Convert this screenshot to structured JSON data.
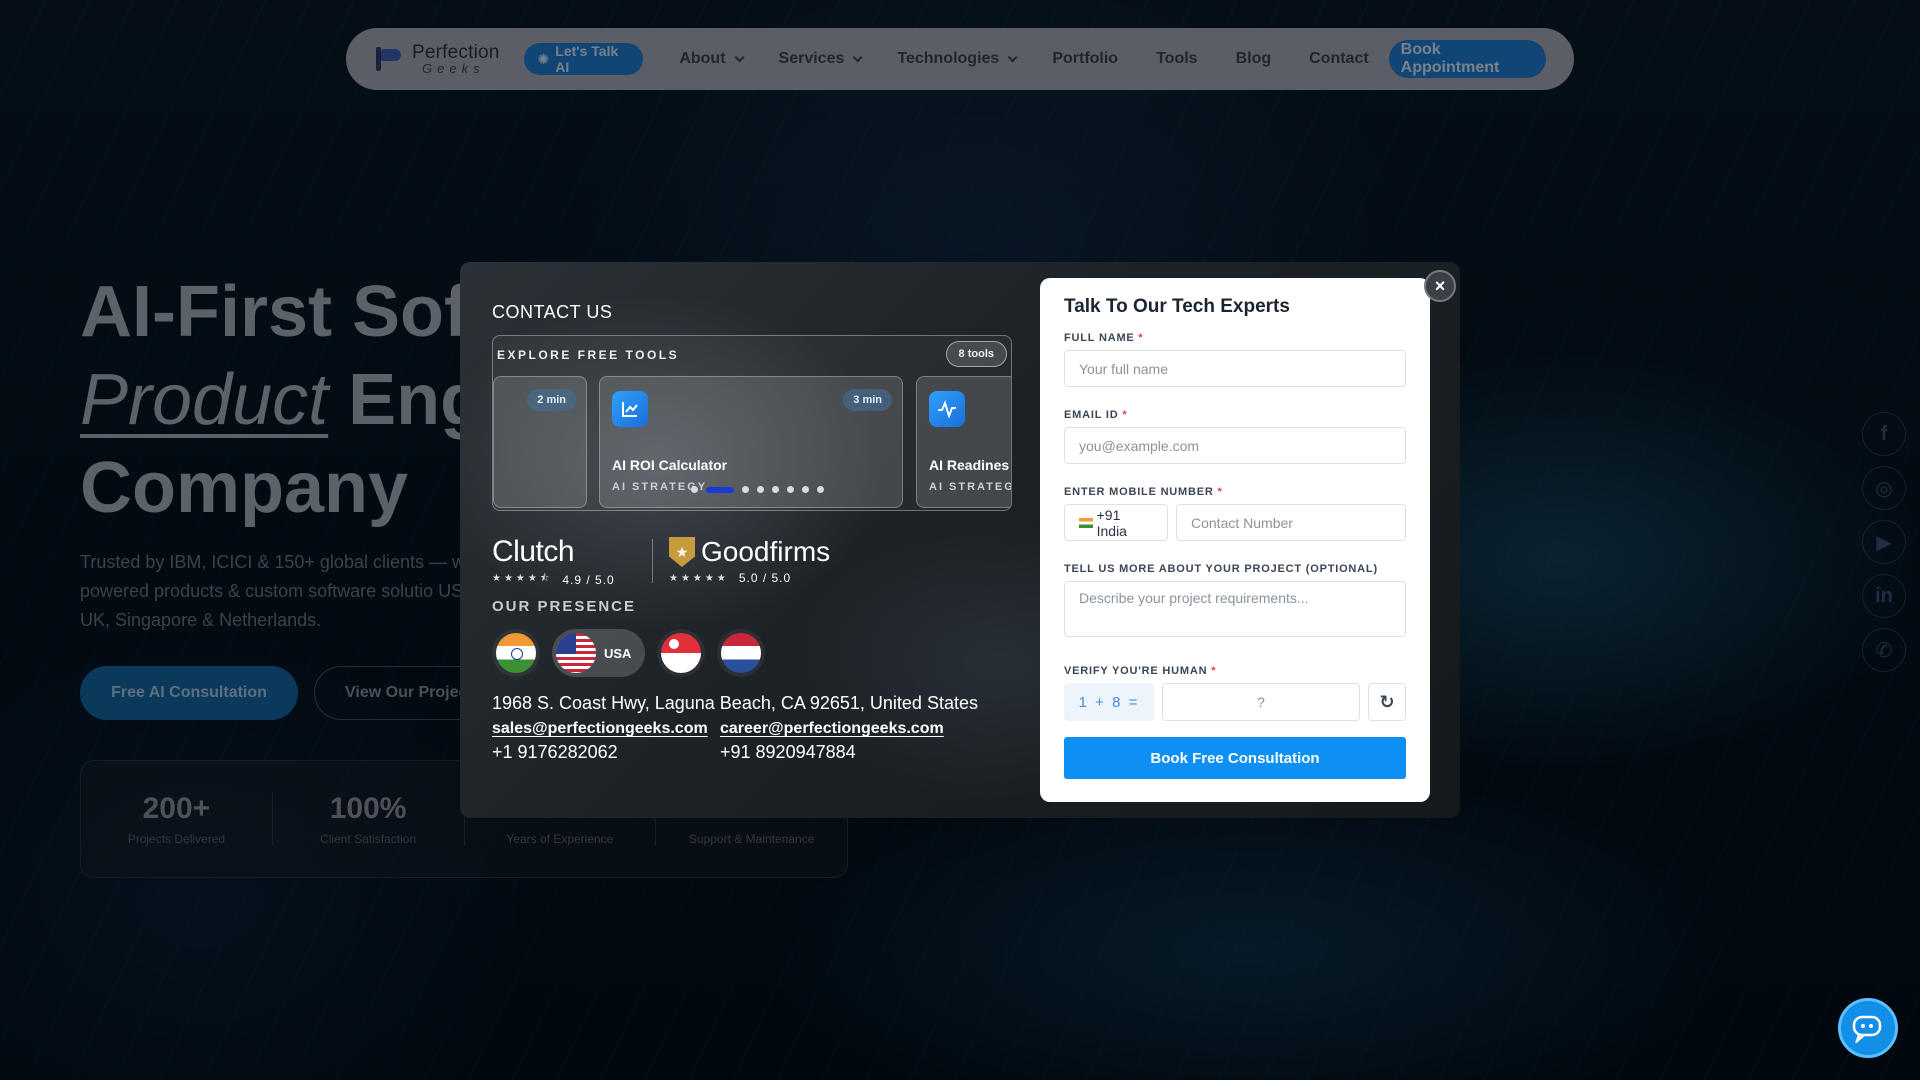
{
  "nav": {
    "logo_line1": "Perfection",
    "logo_line2": "Geeks",
    "ai_button": "Let's Talk AI",
    "links": [
      {
        "label": "About",
        "dropdown": true
      },
      {
        "label": "Services",
        "dropdown": true
      },
      {
        "label": "Technologies",
        "dropdown": true
      },
      {
        "label": "Portfolio",
        "dropdown": false
      },
      {
        "label": "Tools",
        "dropdown": false
      },
      {
        "label": "Blog",
        "dropdown": false
      },
      {
        "label": "Contact",
        "dropdown": false
      }
    ],
    "book_button": "Book Appointment"
  },
  "hero": {
    "title_line1": "AI-First Soft",
    "title_italic": "Product",
    "title_line2_rest": " Eng",
    "title_line3": "Company",
    "subtitle": "Trusted by IBM, ICICI & 150+ global clients — w powered products & custom software solutio USA, UK, Singapore & Netherlands.",
    "primary_button": "Free AI Consultation",
    "secondary_button": "View Our Projec",
    "stats": [
      {
        "value": "200+",
        "label": "Projects Delivered"
      },
      {
        "value": "100%",
        "label": "Client Satisfaction"
      },
      {
        "value": "",
        "label": "Years of Experience"
      },
      {
        "value": "",
        "label": "Support & Maintenance"
      }
    ]
  },
  "modal": {
    "contact_title": "CONTACT US",
    "tools": {
      "heading": "EXPLORE FREE TOOLS",
      "count": "8 tools",
      "cards": [
        {
          "duration": "2 min",
          "name": "",
          "category": ""
        },
        {
          "duration": "3 min",
          "name": "AI ROI Calculator",
          "category": "AI STRATEGY",
          "icon": "chart-line-icon"
        },
        {
          "duration": "",
          "name": "AI Readines",
          "category": "AI STRATEG",
          "icon": "pulse-icon"
        }
      ],
      "active_slide": 1,
      "total_slides": 8
    },
    "ratings": {
      "clutch": {
        "name": "Clutch",
        "score": "4.9 / 5.0",
        "stars": 4.9
      },
      "goodfirms": {
        "name": "Goodfirms",
        "score": "5.0 / 5.0",
        "stars": 5
      }
    },
    "presence_title": "OUR PRESENCE",
    "countries": [
      {
        "code": "in",
        "label": ""
      },
      {
        "code": "us",
        "label": "USA",
        "active": true
      },
      {
        "code": "sg",
        "label": ""
      },
      {
        "code": "nl",
        "label": ""
      }
    ],
    "address": "1968 S. Coast Hwy, Laguna Beach, CA 92651, United States",
    "email_sales": "sales@perfectiongeeks.com",
    "email_career": "career@perfectiongeeks.com",
    "phone1": "+1 9176282062",
    "phone2": "+91 8920947884"
  },
  "form": {
    "title": "Talk To Our Tech Experts",
    "full_name_label": "FULL NAME",
    "full_name_placeholder": "Your full name",
    "email_label": "EMAIL ID",
    "email_placeholder": "you@example.com",
    "mobile_label": "ENTER MOBILE NUMBER",
    "country_code": "+91 India",
    "mobile_placeholder": "Contact Number",
    "project_label": "TELL US MORE ABOUT YOUR PROJECT (OPTIONAL)",
    "project_placeholder": "Describe your project requirements...",
    "captcha_label": "VERIFY YOU'RE HUMAN",
    "captcha_question": "1 + 8 =",
    "captcha_placeholder": "?",
    "submit": "Book Free Consultation",
    "required_mark": "*"
  },
  "close_label": "×",
  "colors": {
    "accent": "#0e8ff3",
    "nav_button": "#1f7fd8",
    "required": "#e53e3e",
    "slider_active": "#1a3ad8",
    "goodfirms_gold": "#c79a3e"
  }
}
